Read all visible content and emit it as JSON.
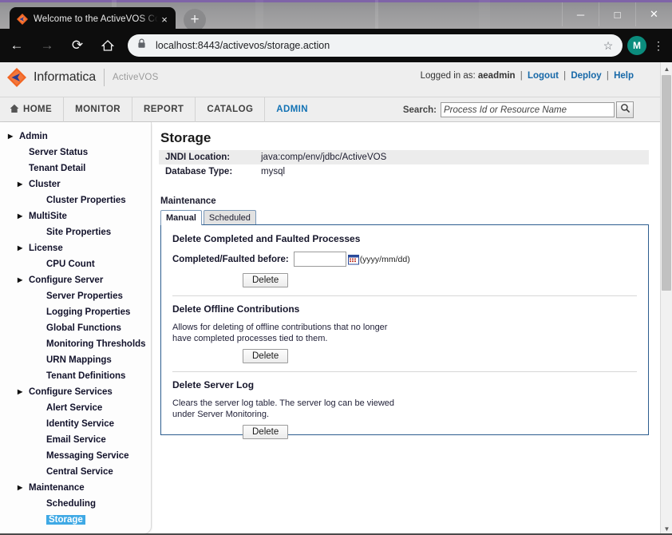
{
  "browser": {
    "tab": {
      "title": "Welcome to the ActiveVOS Cons",
      "close_label": "×",
      "favicon": "activevos-diamond-icon"
    },
    "newtab_label": "+",
    "window_controls": {
      "minimize": "─",
      "maximize": "□",
      "close": "✕"
    },
    "nav": {
      "back": "←",
      "forward": "→",
      "reload": "⟳",
      "home": "⌂"
    },
    "omnibox": {
      "url": "localhost:8443/activevos/storage.action",
      "lock": "lock-icon",
      "star": "☆"
    },
    "profile_initial": "M",
    "menu": "⋮"
  },
  "header": {
    "brand": "Informatica",
    "product": "ActiveVOS",
    "logged_in_prefix": "Logged in as:",
    "username": "aeadmin",
    "links": [
      {
        "label": "Logout"
      },
      {
        "label": "Deploy"
      },
      {
        "label": "Help"
      }
    ]
  },
  "nav": {
    "items": [
      {
        "label": "HOME",
        "icon": "home-icon",
        "active": false
      },
      {
        "label": "MONITOR",
        "active": false
      },
      {
        "label": "REPORT",
        "active": false
      },
      {
        "label": "CATALOG",
        "active": false
      },
      {
        "label": "ADMIN",
        "active": true
      }
    ],
    "search": {
      "label": "Search:",
      "placeholder": "Process Id or Resource Name",
      "value": "",
      "button_icon": "search-icon"
    }
  },
  "sidebar": {
    "items": [
      {
        "label": "Admin",
        "indent": 0,
        "arrow": true,
        "selected": false
      },
      {
        "label": "Server Status",
        "indent": 1,
        "arrow": false,
        "selected": false
      },
      {
        "label": "Tenant Detail",
        "indent": 1,
        "arrow": false,
        "selected": false
      },
      {
        "label": "Cluster",
        "indent": 1,
        "arrow": true,
        "selected": false
      },
      {
        "label": "Cluster Properties",
        "indent": 2,
        "arrow": false,
        "selected": false
      },
      {
        "label": "MultiSite",
        "indent": 1,
        "arrow": true,
        "selected": false
      },
      {
        "label": "Site Properties",
        "indent": 2,
        "arrow": false,
        "selected": false
      },
      {
        "label": "License",
        "indent": 1,
        "arrow": true,
        "selected": false
      },
      {
        "label": "CPU Count",
        "indent": 2,
        "arrow": false,
        "selected": false
      },
      {
        "label": "Configure Server",
        "indent": 1,
        "arrow": true,
        "selected": false
      },
      {
        "label": "Server Properties",
        "indent": 2,
        "arrow": false,
        "selected": false
      },
      {
        "label": "Logging Properties",
        "indent": 2,
        "arrow": false,
        "selected": false
      },
      {
        "label": "Global Functions",
        "indent": 2,
        "arrow": false,
        "selected": false
      },
      {
        "label": "Monitoring Thresholds",
        "indent": 2,
        "arrow": false,
        "selected": false
      },
      {
        "label": "URN Mappings",
        "indent": 2,
        "arrow": false,
        "selected": false
      },
      {
        "label": "Tenant Definitions",
        "indent": 2,
        "arrow": false,
        "selected": false
      },
      {
        "label": "Configure Services",
        "indent": 1,
        "arrow": true,
        "selected": false
      },
      {
        "label": "Alert Service",
        "indent": 2,
        "arrow": false,
        "selected": false
      },
      {
        "label": "Identity Service",
        "indent": 2,
        "arrow": false,
        "selected": false
      },
      {
        "label": "Email Service",
        "indent": 2,
        "arrow": false,
        "selected": false
      },
      {
        "label": "Messaging Service",
        "indent": 2,
        "arrow": false,
        "selected": false
      },
      {
        "label": "Central Service",
        "indent": 2,
        "arrow": false,
        "selected": false
      },
      {
        "label": "Maintenance",
        "indent": 1,
        "arrow": true,
        "selected": false
      },
      {
        "label": "Scheduling",
        "indent": 2,
        "arrow": false,
        "selected": false
      },
      {
        "label": "Storage",
        "indent": 2,
        "arrow": false,
        "selected": true
      }
    ]
  },
  "main": {
    "title": "Storage",
    "info_rows": [
      {
        "key": "JNDI Location:",
        "value": "java:comp/env/jdbc/ActiveVOS"
      },
      {
        "key": "Database Type:",
        "value": "mysql"
      }
    ],
    "maintenance_heading": "Maintenance",
    "tabs": [
      {
        "label": "Manual",
        "active": true
      },
      {
        "label": "Scheduled",
        "active": false
      }
    ],
    "sections": [
      {
        "title": "Delete Completed and Faulted Processes",
        "field_label": "Completed/Faulted before:",
        "field_value": "",
        "field_icon": "calendar-icon",
        "format_hint": "(yyyy/mm/dd)",
        "button": "Delete"
      },
      {
        "title": "Delete Offline Contributions",
        "description_line1": "Allows for deleting of offline contributions that no longer",
        "description_line2": "have completed processes tied to them.",
        "button": "Delete"
      },
      {
        "title": "Delete Server Log",
        "description_line1": "Clears the server log table. The server log can be viewed",
        "description_line2": "under Server Monitoring.",
        "button": "Delete"
      }
    ]
  },
  "scrollbar": {
    "up": "▲",
    "down": "▼"
  },
  "colors": {
    "accent_blue": "#1272b4",
    "link_blue": "#1668a8",
    "selection_blue": "#3fa9e5",
    "panel_border": "#2c5d8f",
    "brand_orange": "#f26522",
    "avatar_teal": "#0b8c7d"
  }
}
